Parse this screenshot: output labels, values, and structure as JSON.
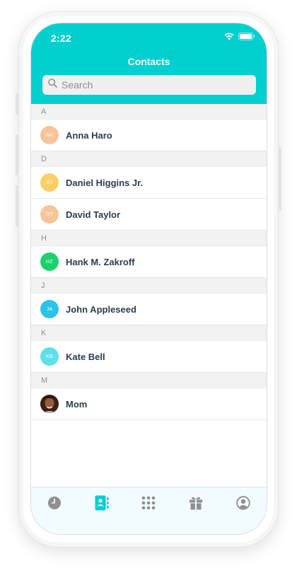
{
  "status_bar": {
    "time": "2:22"
  },
  "header": {
    "title": "Contacts"
  },
  "search": {
    "placeholder": "Search"
  },
  "sections": [
    {
      "letter": "A",
      "contacts": [
        {
          "name": "Anna Haro",
          "initials": "AH",
          "color": "#f8c49a"
        }
      ]
    },
    {
      "letter": "D",
      "contacts": [
        {
          "name": "Daniel Higgins Jr.",
          "initials": "DJ",
          "color": "#fccf66"
        },
        {
          "name": "David Taylor",
          "initials": "DT",
          "color": "#f8c49a"
        }
      ]
    },
    {
      "letter": "H",
      "contacts": [
        {
          "name": "Hank M. Zakroff",
          "initials": "HZ",
          "color": "#1bd16a"
        }
      ]
    },
    {
      "letter": "J",
      "contacts": [
        {
          "name": "John Appleseed",
          "initials": "JA",
          "color": "#2bc3e8"
        }
      ]
    },
    {
      "letter": "K",
      "contacts": [
        {
          "name": "Kate Bell",
          "initials": "KB",
          "color": "#5ee0ea"
        }
      ]
    },
    {
      "letter": "M",
      "contacts": [
        {
          "name": "Mom",
          "initials": "",
          "color": "#6a3c2b"
        }
      ]
    }
  ],
  "tabbar": {
    "items": [
      {
        "icon": "clock-icon",
        "active": false
      },
      {
        "icon": "contacts-book-icon",
        "active": true
      },
      {
        "icon": "keypad-icon",
        "active": false
      },
      {
        "icon": "gift-icon",
        "active": false
      },
      {
        "icon": "profile-icon",
        "active": false
      }
    ],
    "active_color": "#00cfcf",
    "inactive_color": "#8e8e93"
  },
  "colors": {
    "accent": "#00cfcf",
    "name_text": "#2b3e50"
  }
}
